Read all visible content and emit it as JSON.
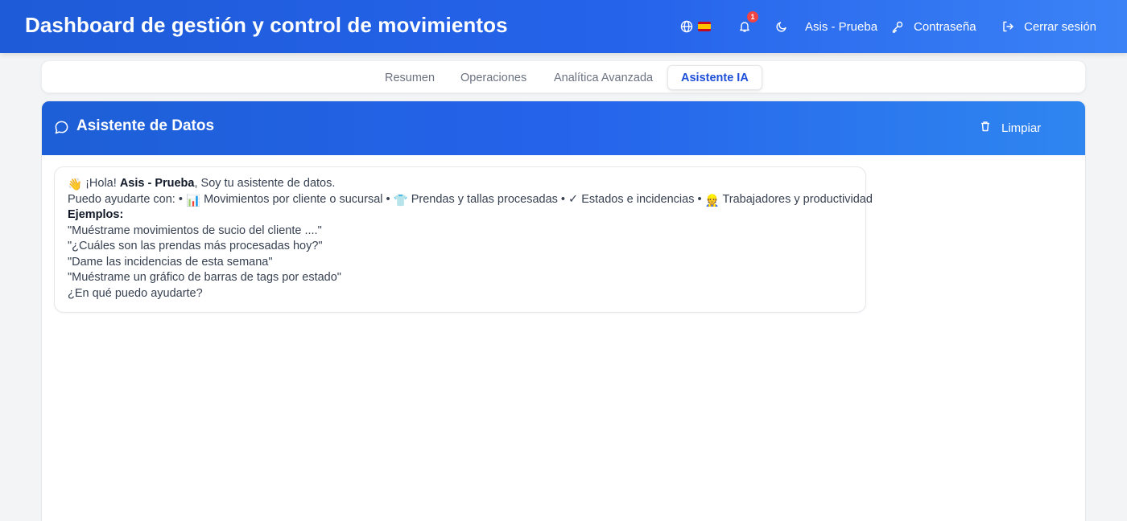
{
  "header": {
    "title": "Dashboard de gestión y control de movimientos",
    "language_icon": "globe-icon",
    "language_flag": "spain-flag",
    "notifications_count": "1",
    "theme_icon": "moon-icon",
    "user_name": "Asis - Prueba",
    "password_label": "Contraseña",
    "logout_label": "Cerrar sesión",
    "colors": {
      "primary": "#2563eb",
      "accent_light": "#3b82f6"
    }
  },
  "tabs": [
    {
      "label": "Resumen",
      "active": false
    },
    {
      "label": "Operaciones",
      "active": false
    },
    {
      "label": "Analítica Avanzada",
      "active": false
    },
    {
      "label": "Asistente IA",
      "active": true
    }
  ],
  "assistant": {
    "title": "Asistente de Datos",
    "title_icon": "chat-bubble-icon",
    "clear_label": "Limpiar",
    "clear_icon": "trash-icon",
    "message": {
      "greet_emoji": "👋",
      "greet_prefix": "¡Hola! ",
      "user_name": "Asis - Prueba",
      "greet_suffix": ", Soy tu asistente de datos.",
      "intro": "Puedo ayudarte con: •",
      "item1_emoji": "📊",
      "item1": "Movimientos por cliente o sucursal •",
      "item2_emoji": "👕",
      "item2": "Prendas y tallas procesadas •",
      "item3": "✓ Estados e incidencias •",
      "item4_emoji": "👷",
      "item4": "Trabajadores y productividad",
      "examples_label": "Ejemplos:",
      "examples": [
        "\"Muéstrame movimientos de sucio del cliente ....\"",
        "\"¿Cuáles son las prendas más procesadas hoy?\"",
        "\"Dame las incidencias de esta semana\"",
        "\"Muéstrame un gráfico de barras de tags por estado\""
      ],
      "closing": "¿En qué puedo ayudarte?"
    }
  }
}
